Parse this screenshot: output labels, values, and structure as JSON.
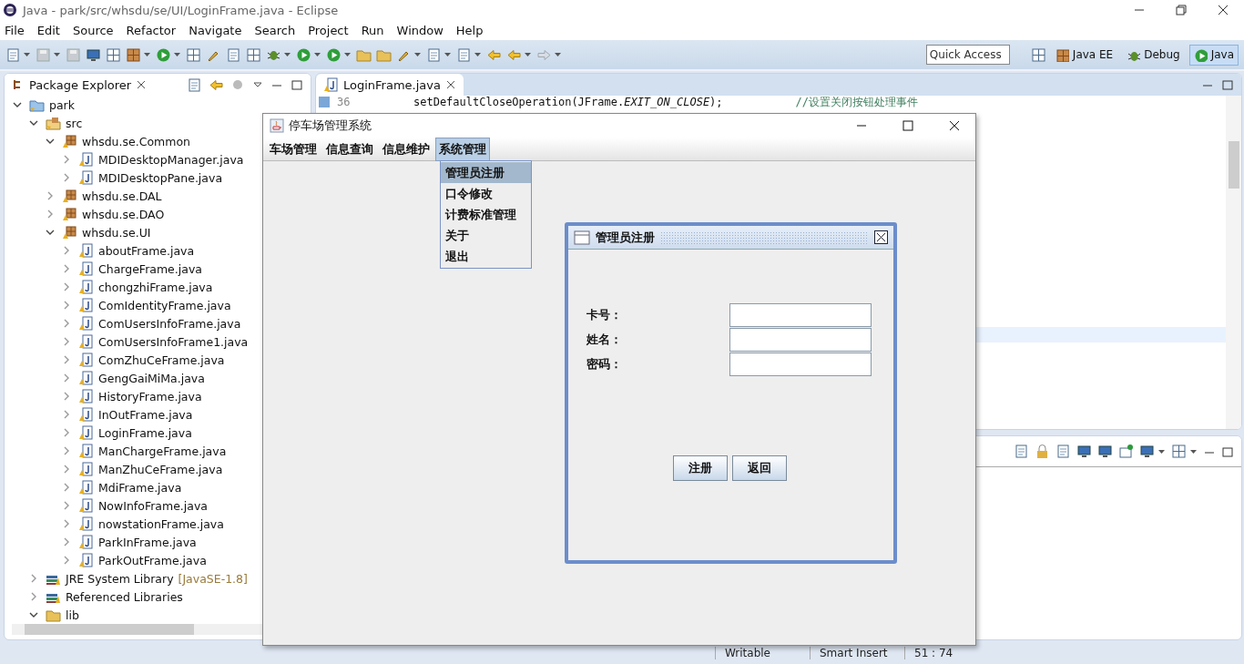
{
  "window": {
    "title": "Java - park/src/whsdu/se/UI/LoginFrame.java - Eclipse"
  },
  "menu_bar": [
    "File",
    "Edit",
    "Source",
    "Refactor",
    "Navigate",
    "Search",
    "Project",
    "Run",
    "Window",
    "Help"
  ],
  "toolbar": {
    "quick_access": {
      "placeholder": "Quick Access"
    },
    "perspectives": [
      {
        "label": "Java EE",
        "selected": false
      },
      {
        "label": "Debug",
        "selected": false
      },
      {
        "label": "Java",
        "selected": true
      }
    ]
  },
  "package_explorer": {
    "title": "Package Explorer",
    "tree": [
      {
        "label": "park",
        "kind": "project",
        "expanded": true,
        "children": [
          {
            "label": "src",
            "kind": "source",
            "expanded": true,
            "children": [
              {
                "label": "whsdu.se.Common",
                "kind": "package",
                "expanded": true,
                "children": [
                  {
                    "label": "MDIDesktopManager.java",
                    "kind": "file",
                    "expanded": false
                  },
                  {
                    "label": "MDIDesktopPane.java",
                    "kind": "file",
                    "expanded": false
                  }
                ]
              },
              {
                "label": "whsdu.se.DAL",
                "kind": "package",
                "expanded": false
              },
              {
                "label": "whsdu.se.DAO",
                "kind": "package",
                "expanded": false
              },
              {
                "label": "whsdu.se.UI",
                "kind": "package",
                "expanded": true,
                "children": [
                  {
                    "label": "aboutFrame.java",
                    "kind": "file",
                    "expanded": false
                  },
                  {
                    "label": "ChargeFrame.java",
                    "kind": "file",
                    "expanded": false
                  },
                  {
                    "label": "chongzhiFrame.java",
                    "kind": "file",
                    "expanded": false
                  },
                  {
                    "label": "ComIdentityFrame.java",
                    "kind": "file",
                    "expanded": false
                  },
                  {
                    "label": "ComUsersInfoFrame.java",
                    "kind": "file",
                    "expanded": false
                  },
                  {
                    "label": "ComUsersInfoFrame1.java",
                    "kind": "file",
                    "expanded": false
                  },
                  {
                    "label": "ComZhuCeFrame.java",
                    "kind": "file",
                    "expanded": false
                  },
                  {
                    "label": "GengGaiMiMa.java",
                    "kind": "file",
                    "expanded": false
                  },
                  {
                    "label": "HistoryFrame.java",
                    "kind": "file",
                    "expanded": false
                  },
                  {
                    "label": "InOutFrame.java",
                    "kind": "file",
                    "expanded": false
                  },
                  {
                    "label": "LoginFrame.java",
                    "kind": "file",
                    "expanded": false
                  },
                  {
                    "label": "ManChargeFrame.java",
                    "kind": "file",
                    "expanded": false
                  },
                  {
                    "label": "ManZhuCeFrame.java",
                    "kind": "file",
                    "expanded": false
                  },
                  {
                    "label": "MdiFrame.java",
                    "kind": "file",
                    "expanded": false
                  },
                  {
                    "label": "NowInfoFrame.java",
                    "kind": "file",
                    "expanded": false
                  },
                  {
                    "label": "nowstationFrame.java",
                    "kind": "file",
                    "expanded": false
                  },
                  {
                    "label": "ParkInFrame.java",
                    "kind": "file",
                    "expanded": false
                  },
                  {
                    "label": "ParkOutFrame.java",
                    "kind": "file",
                    "expanded": false
                  }
                ]
              }
            ]
          },
          {
            "label": "JRE System Library",
            "decoration": "[JavaSE-1.8]",
            "kind": "library",
            "expanded": false
          },
          {
            "label": "Referenced Libraries",
            "kind": "library",
            "expanded": false
          },
          {
            "label": "lib",
            "kind": "folder",
            "expanded": true
          }
        ]
      }
    ]
  },
  "editor": {
    "tab": "LoginFrame.java",
    "lines": [
      {
        "number": "36",
        "code": "setDefaultCloseOperation(JFrame.*EXIT_ON_CLOSE*);",
        "comment": "//设置关闭按钮处理事件"
      }
    ]
  },
  "status_bar": [
    "Writable",
    "Smart Insert",
    "51 : 74"
  ],
  "app_window": {
    "title": "停车场管理系统",
    "menus": [
      {
        "label": "车场管理",
        "selected": false
      },
      {
        "label": "信息查询",
        "selected": false
      },
      {
        "label": "信息维护",
        "selected": false
      },
      {
        "label": "系统管理",
        "selected": true
      }
    ],
    "open_menu": [
      {
        "label": "管理员注册",
        "selected": true
      },
      {
        "label": "口令修改",
        "selected": false
      },
      {
        "label": "计费标准管理",
        "selected": false
      },
      {
        "label": "关于",
        "selected": false
      },
      {
        "label": "退出",
        "selected": false
      }
    ],
    "dialog": {
      "title": "管理员注册",
      "fields": [
        {
          "label": "卡号："
        },
        {
          "label": "姓名："
        },
        {
          "label": "密码："
        }
      ],
      "buttons": [
        "注册",
        "返回"
      ]
    }
  }
}
